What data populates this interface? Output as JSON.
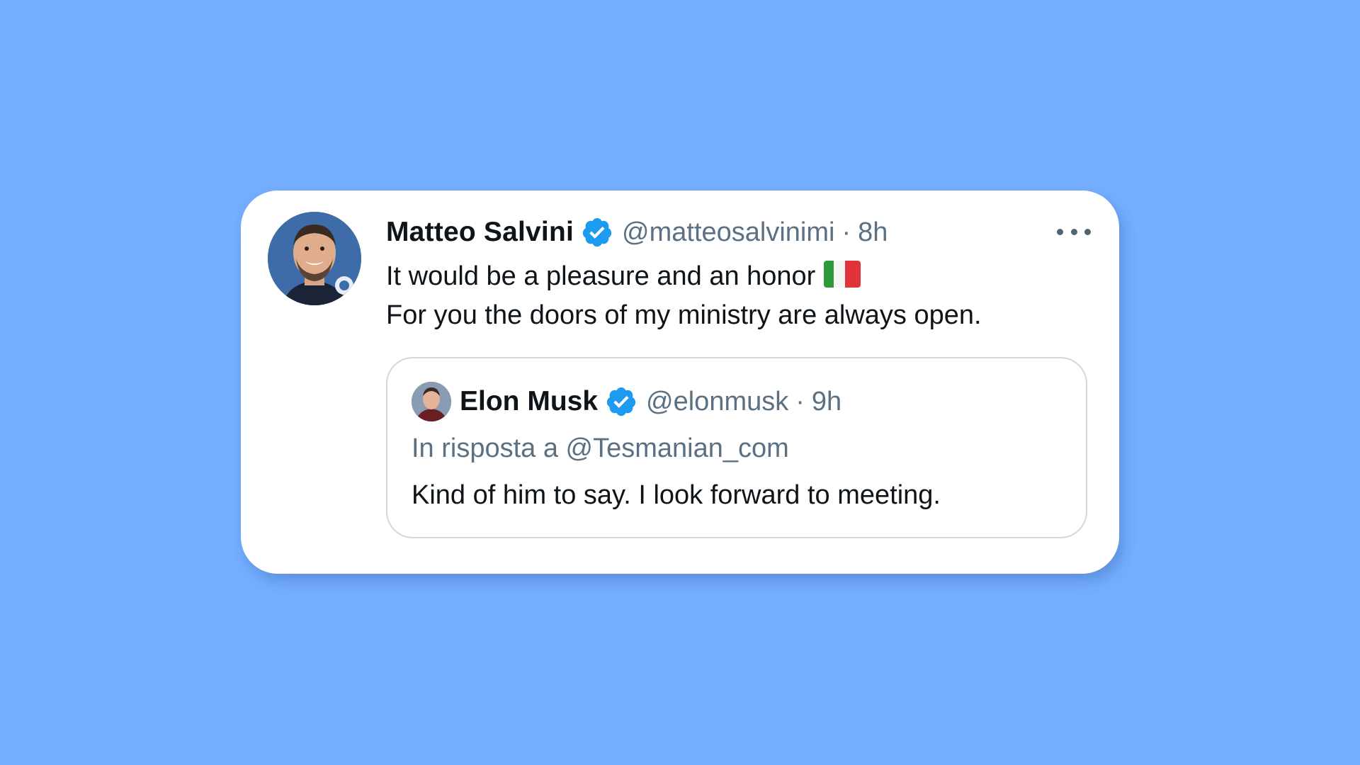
{
  "tweet": {
    "author_name": "Matteo Salvini",
    "handle": "@matteosalvinimi",
    "separator": "·",
    "time": "8h",
    "text_line1": "It would be a pleasure and an honor",
    "text_line2": "For you the doors of my ministry are always open.",
    "flag_icon": "italy-flag-icon",
    "verified": true
  },
  "quoted_tweet": {
    "author_name": "Elon Musk",
    "handle": "@elonmusk",
    "separator": "·",
    "time": "9h",
    "reply_context": "In risposta a @Tesmanian_com",
    "text": "Kind of him to say. I look forward to meeting.",
    "verified": true
  },
  "colors": {
    "background": "#74aeff",
    "card": "#ffffff",
    "verified_blue": "#1d9bf0",
    "secondary_text": "#5b7083",
    "primary_text": "#0f1419"
  }
}
